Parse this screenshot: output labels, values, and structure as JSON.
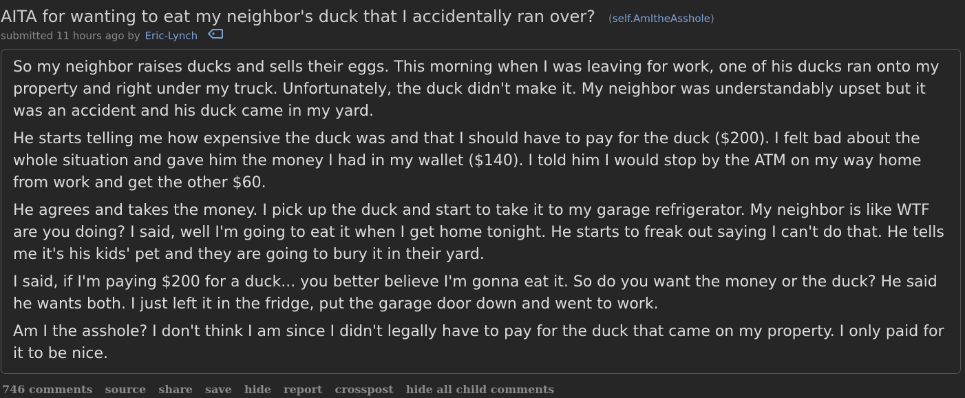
{
  "post": {
    "title": "AITA for wanting to eat my neighbor's duck that I accidentally ran over?",
    "domain_open": "(",
    "domain": "self.AmItheAsshole",
    "domain_close": ")",
    "submitted_prefix": "submitted 11 hours ago by",
    "author": "Eric-Lynch",
    "flair_icon": "tag-icon"
  },
  "body": {
    "paragraphs": [
      "So my neighbor raises ducks and sells their eggs. This morning when I was leaving for work, one of his ducks ran onto my property and right under my truck. Unfortunately, the duck didn't make it. My neighbor was understandably upset but it was an accident and his duck came in my yard.",
      "He starts telling me how expensive the duck was and that I should have to pay for the duck ($200). I felt bad about the whole situation and gave him the money I had in my wallet ($140). I told him I would stop by the ATM on my way home from work and get the other $60.",
      "He agrees and takes the money. I pick up the duck and start to take it to my garage refrigerator. My neighbor is like WTF are you doing? I said, well I'm going to eat it when I get home tonight. He starts to freak out saying I can't do that. He tells me it's his kids' pet and they are going to bury it in their yard.",
      "I said, if I'm paying $200 for a duck... you better believe I'm gonna eat it. So do you want the money or the duck? He said he wants both. I just left it in the fridge, put the garage door down and went to work.",
      "Am I the asshole? I don't think I am since I didn't legally have to pay for the duck that came on my property. I only paid for it to be nice."
    ]
  },
  "actions": {
    "comments": "746 comments",
    "source": "source",
    "share": "share",
    "save": "save",
    "hide": "hide",
    "report": "report",
    "crosspost": "crosspost",
    "hide_all": "hide all child comments"
  },
  "colors": {
    "background": "#262626",
    "text": "#dcdcdc",
    "link": "#7aa2d6",
    "muted": "#8a8a8a",
    "border": "#555555"
  }
}
